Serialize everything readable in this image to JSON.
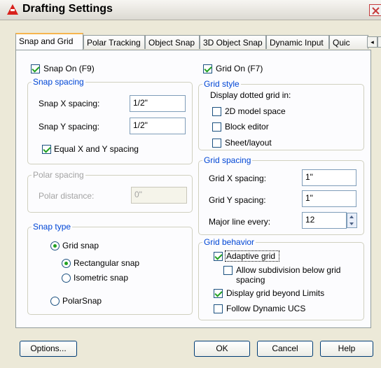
{
  "window": {
    "title": "Drafting Settings",
    "colors": {
      "accent_green": "#21a121",
      "group_title": "#0046d5",
      "title_icon": "#d8211c"
    }
  },
  "tabs": [
    "Snap and Grid",
    "Polar Tracking",
    "Object Snap",
    "3D Object Snap",
    "Dynamic Input",
    "Quic"
  ],
  "tab_scroll": {
    "left": "◂",
    "right": "▸"
  },
  "snap_on": {
    "label": "Snap On (F9)",
    "checked": true
  },
  "grid_on": {
    "label": "Grid On (F7)",
    "checked": true
  },
  "snap_spacing": {
    "title": "Snap spacing",
    "x_label": "Snap X spacing:",
    "x_value": "1/2\"",
    "y_label": "Snap Y spacing:",
    "y_value": "1/2\"",
    "equal_label": "Equal X and Y spacing",
    "equal_checked": true
  },
  "polar_spacing": {
    "title": "Polar spacing",
    "distance_label": "Polar distance:",
    "distance_value": "0\""
  },
  "snap_type": {
    "title": "Snap type",
    "grid_snap": "Grid snap",
    "rectangular": "Rectangular snap",
    "isometric": "Isometric snap",
    "polar": "PolarSnap",
    "selected": "grid_snap",
    "sub_selected": "rectangular"
  },
  "grid_style": {
    "title": "Grid style",
    "heading": "Display dotted grid in:",
    "model": "2D model space",
    "block": "Block editor",
    "sheet": "Sheet/layout"
  },
  "grid_spacing": {
    "title": "Grid spacing",
    "x_label": "Grid X spacing:",
    "x_value": "1\"",
    "y_label": "Grid Y spacing:",
    "y_value": "1\"",
    "major_label": "Major line every:",
    "major_value": "12"
  },
  "grid_behavior": {
    "title": "Grid behavior",
    "adaptive": "Adaptive grid",
    "adaptive_checked": true,
    "subdivision_line1": "Allow subdivision below grid",
    "subdivision_line2": "spacing",
    "beyond": "Display grid beyond Limits",
    "beyond_checked": true,
    "follow": "Follow Dynamic UCS"
  },
  "buttons": {
    "options": "Options...",
    "ok": "OK",
    "cancel": "Cancel",
    "help": "Help"
  }
}
